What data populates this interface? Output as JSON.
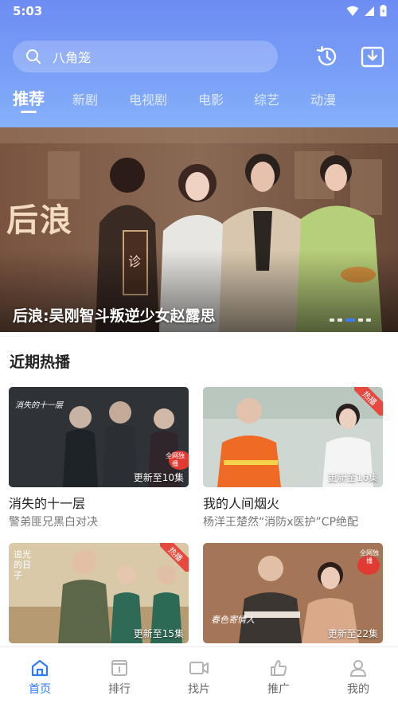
{
  "status": {
    "time": "5:03"
  },
  "search": {
    "text": "八角笼"
  },
  "tabs": [
    {
      "label": "推荐"
    },
    {
      "label": "新剧"
    },
    {
      "label": "电视剧"
    },
    {
      "label": "电影"
    },
    {
      "label": "综艺"
    },
    {
      "label": "动漫"
    }
  ],
  "banner": {
    "poster_title": "后浪",
    "poster_badge": "诊",
    "title": "后浪:吴刚智斗叛逆少女赵露思",
    "dots_count": 5,
    "active_dot": 2
  },
  "section": {
    "title": "近期热播"
  },
  "cards": [
    {
      "title": "消失的十一层",
      "subtitle": "警弟匪兄黑白对决",
      "update": "更新至10集",
      "poster_text": "消失的十一层",
      "hot": "",
      "badge": "全网独播"
    },
    {
      "title": "我的人间烟火",
      "subtitle": "杨洋王楚然“消防x医护”CP绝配",
      "update": "更新至16集",
      "poster_text": "",
      "hot": "热播",
      "badge": ""
    },
    {
      "title": "",
      "subtitle": "",
      "update": "更新至15集",
      "poster_text": "追光的日子",
      "hot": "热播",
      "badge": ""
    },
    {
      "title": "",
      "subtitle": "",
      "update": "更新至22集",
      "poster_text": "春色寄情人",
      "hot": "",
      "badge": "全网独播"
    }
  ],
  "bottom_nav": [
    {
      "label": "首页",
      "icon": "home-icon"
    },
    {
      "label": "排行",
      "icon": "ranking-icon"
    },
    {
      "label": "找片",
      "icon": "video-camera-icon"
    },
    {
      "label": "推广",
      "icon": "thumbs-up-icon"
    },
    {
      "label": "我的",
      "icon": "user-icon"
    }
  ],
  "colors": {
    "accent": "#2f7cf6",
    "header_start": "#6d8cf3",
    "header_end": "#86b1fb",
    "hot": "#e8493f"
  }
}
